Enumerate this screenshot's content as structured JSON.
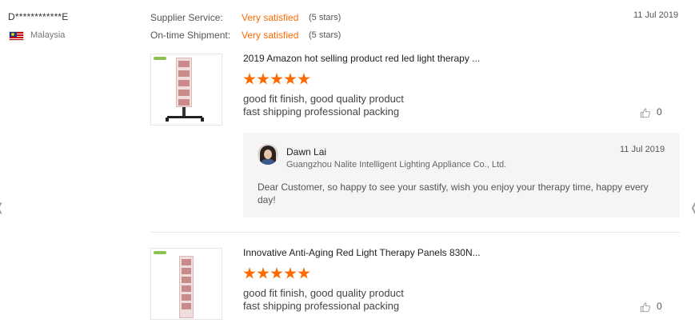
{
  "nav": {
    "prev_icon": "chevron-left-icon",
    "next_icon": "chevron-right-icon"
  },
  "reviewer": {
    "name": "D************E",
    "country": "Malaysia",
    "flag_icon": "malaysia-flag-icon"
  },
  "ratings": [
    {
      "label": "Supplier Service:",
      "value": "Very satisfied",
      "stars": "(5 stars)"
    },
    {
      "label": "On-time Shipment:",
      "value": "Very satisfied",
      "stars": "(5 stars)"
    }
  ],
  "review_date": "11 Jul 2019",
  "accent_color": "#ff6a00",
  "products": [
    {
      "title": "2019 Amazon hot selling product red led light therapy ...",
      "stars": 5,
      "review_lines": [
        "good fit finish, good quality product",
        "fast shipping professional packing"
      ],
      "likes": "0"
    },
    {
      "title": "Innovative Anti-Aging Red Light Therapy Panels 830N...",
      "stars": 5,
      "review_lines": [
        "good fit finish, good quality product",
        "fast shipping professional packing"
      ],
      "likes": "0"
    }
  ],
  "reply": {
    "name": "Dawn Lai",
    "company": "Guangzhou Nalite Intelligent Lighting Appliance Co., Ltd.",
    "date": "11 Jul 2019",
    "text": "Dear Customer, so happy to see your sastify, wish you enjoy your therapy time, happy every day!"
  }
}
